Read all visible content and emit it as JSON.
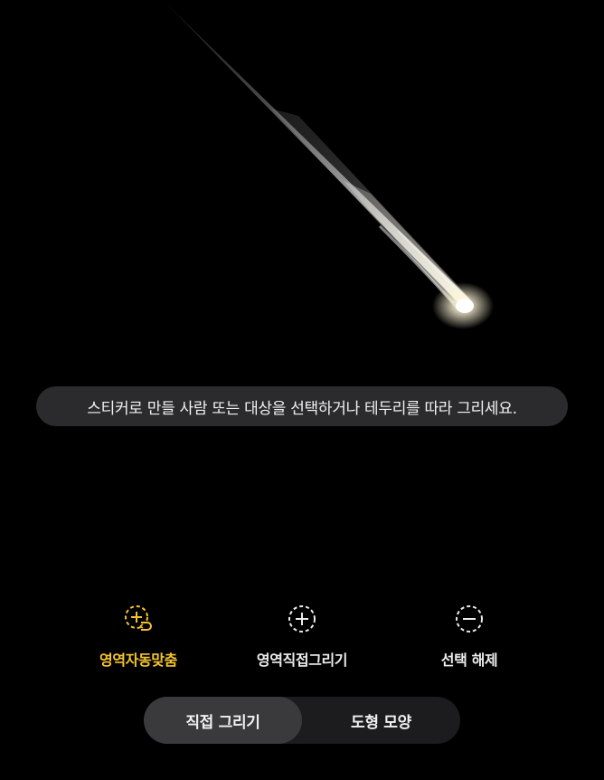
{
  "hint_text": "스티커로 만들 사람 또는 대상을 선택하거나 테두리를 따라 그리세요.",
  "tools": {
    "auto": {
      "label": "영역자동맞춤",
      "icon": "auto-fit-selection-icon",
      "active": true
    },
    "draw": {
      "label": "영역직접그리기",
      "icon": "plus-dashed-circle-icon",
      "active": false
    },
    "deselect": {
      "label": "선택 해제",
      "icon": "minus-dashed-circle-icon",
      "active": false
    }
  },
  "mode_toggle": {
    "options": [
      "직접 그리기",
      "도형 모양"
    ],
    "selected": "직접 그리기"
  },
  "colors": {
    "background": "#000000",
    "accent": "#f4c430",
    "hint_bg": "#2b2b2d",
    "segment_bg": "#1c1c1e",
    "segment_selected": "#3a3a3c"
  }
}
